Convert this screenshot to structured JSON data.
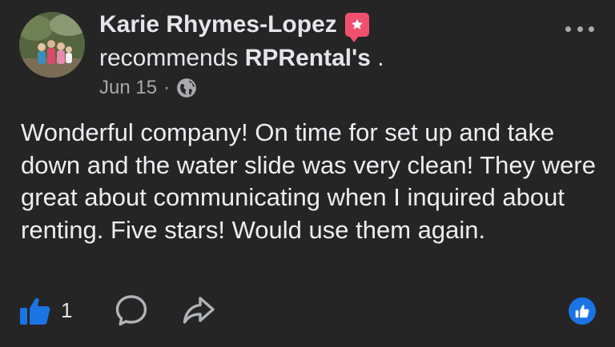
{
  "post": {
    "author": "Karie Rhymes-Lopez",
    "verb": "recommends",
    "page_name": "RPRental's",
    "trailing_punct": " .",
    "date": "Jun 15",
    "separator": "·",
    "audience_icon": "globe-icon",
    "text": "Wonderful company! On time for set up and take down and the water slide was very clean! They were great about communicating when I inquired about renting. Five stars! Would use them again."
  },
  "actions": {
    "like_icon": "thumbs-up-icon",
    "like_count": "1",
    "comment_icon": "comment-icon",
    "share_icon": "share-icon",
    "reaction_icon": "like-reaction-icon"
  },
  "colors": {
    "background": "#252526",
    "text": "#e4e6eb",
    "secondary_text": "#a7a9ad",
    "accent_blue": "#1b74e4",
    "recommend_badge": "#f0506e"
  }
}
